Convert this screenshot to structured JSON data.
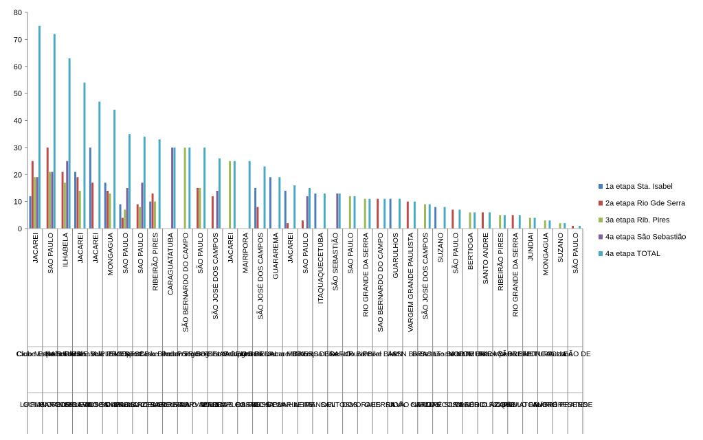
{
  "chart_data": {
    "type": "bar",
    "ylim": [
      0,
      80
    ],
    "yticks": [
      0,
      10,
      20,
      30,
      40,
      50,
      60,
      70,
      80
    ],
    "grid": false,
    "legend_position": "right",
    "categories": [
      {
        "city": "JACAREI",
        "team": "Ciclo Mania",
        "name": "GIRLEI"
      },
      {
        "city": "SAO PAULO",
        "team": "Clube Esporte Clube",
        "name": "LUCIANO ANGELI"
      },
      {
        "city": "ILHABELA",
        "team": "Ilhabela Bike",
        "name": "MARCOS SILVA"
      },
      {
        "city": "JACAREI",
        "team": "Sul de Ilhabela",
        "name": "PEDRO SANTOS"
      },
      {
        "city": "JACAREI",
        "team": "NATURAIS E SUPLEMENTOS",
        "name": "RICARDO SOUZA"
      },
      {
        "city": "MONGAGUA",
        "team": "Vale PROD.",
        "name": "JOSE CARLOS"
      },
      {
        "city": "SAO PAULO",
        "team": "Bike Sport",
        "name": "ANDRE LUIZ"
      },
      {
        "city": "SAO PAULO",
        "team": "Speed Bike",
        "name": "PAULO CESAR"
      },
      {
        "city": "RIBEIRÃO PIRES",
        "team": "Casa Bike",
        "name": "MARCELO SILVA"
      },
      {
        "city": "CARAGUATATUBA",
        "team": "Berdam",
        "name": "FABIO LIMA"
      },
      {
        "city": "SÃO BERNARDO DO CAMPO",
        "team": "Pedal Seguros",
        "name": "ANDRE CARVALHO"
      },
      {
        "city": "SÃO PAULO",
        "team": "Porto Seguros",
        "name": "FABIO SOUSA"
      },
      {
        "city": "SÃO JOSÉ DOS CAMPOS",
        "team": "TRIBO SELVAGEM",
        "name": "PEDRA"
      },
      {
        "city": "JACAREI",
        "team": "Tribo Selvagem",
        "name": "MARCOS COSTA"
      },
      {
        "city": "MAIRIPORA",
        "team": "Mairipora Bike",
        "name": "CARLOS ROCHA"
      },
      {
        "city": "SÃO JOSÉ DOS CAMPOS",
        "team": "DO PEDAL",
        "name": "RAFAEL SILVA"
      },
      {
        "city": "GUARAREMA",
        "team": "Guararema MTB",
        "name": "JOSÉ CUNHA"
      },
      {
        "city": "JACAREI",
        "team": "Jacarei Bikers",
        "name": "CESAR LEITE"
      },
      {
        "city": "SAO PAULO",
        "team": "BIKERS",
        "name": "LEITE"
      },
      {
        "city": "ITAQUAQUECETUBA",
        "team": "Itaqua Bike",
        "name": "MANOEL"
      },
      {
        "city": "SÃO SEBASTIÃO",
        "team": "DESAFIO",
        "name": "SANTOS"
      },
      {
        "city": "SAO PAULO",
        "team": "Desafio Bike",
        "name": "DOS"
      },
      {
        "city": "RIO GRANDE DA SERRA",
        "team": "Rural Bike",
        "name": "MORAES"
      },
      {
        "city": "SAO BERNARDO DO CAMPO",
        "team": "Pedal Bike",
        "name": "GUERRA"
      },
      {
        "city": "GUARULHOS",
        "team": "ASN",
        "name": "SILVA"
      },
      {
        "city": "VARGEM GRANDE PAULISTA",
        "team": "ASN Bikers",
        "name": "JOÃO NETO"
      },
      {
        "city": "SÃO JOSÉ DOS CAMPOS",
        "team": "BRASIL",
        "name": "CARLOS"
      },
      {
        "city": "SUZANO",
        "team": "Suzano Bike",
        "name": "ANDRÉ SILVA"
      },
      {
        "city": "SÃO PAULO",
        "team": "Team Norte",
        "name": "MARCOS PEDRO"
      },
      {
        "city": "BERTIOGA",
        "team": "NORTE BIKE",
        "name": "ROGÉRIO"
      },
      {
        "city": "SANTO ANDRE",
        "team": "COMUNICAÇÃO",
        "name": "CLAUDIO ROQUE"
      },
      {
        "city": "RIBEIRÃO PIRES",
        "team": "Ribeirão Bike",
        "name": "LÁZARO"
      },
      {
        "city": "RIO GRANDE DA SERRA",
        "team": "Serra Bike",
        "name": "JOSÉ MATOS"
      },
      {
        "city": "JUNDIAI",
        "team": "PREFEITURA",
        "name": "PAULO FAUSTO"
      },
      {
        "city": "MONGAGUA",
        "team": "MONGAGUA",
        "name": "MÁRIO"
      },
      {
        "city": "SUZANO",
        "team": "Suzano",
        "name": "ANDRÉ PRATES"
      },
      {
        "city": "SÃO PAULO",
        "team": "LEÃO DE",
        "name": "RESENDE"
      }
    ],
    "series": [
      {
        "name": "1a etapa Sta. Isabel",
        "color": "#4a7ebb",
        "values": [
          12,
          0,
          0,
          21,
          30,
          17,
          9,
          0,
          10,
          0,
          0,
          0,
          0,
          0,
          0,
          15,
          19,
          14,
          0,
          13,
          0,
          0,
          0,
          0,
          11,
          0,
          0,
          8,
          0,
          0,
          0,
          0,
          0,
          0,
          0,
          0,
          0
        ]
      },
      {
        "name": "2a etapa Rio Gde Serra",
        "color": "#be4b48",
        "values": [
          25,
          30,
          21,
          19,
          17,
          14,
          4,
          9,
          13,
          0,
          0,
          15,
          12,
          0,
          0,
          8,
          0,
          2,
          3,
          0,
          0,
          0,
          0,
          11,
          0,
          10,
          0,
          0,
          7,
          0,
          6,
          0,
          5,
          0,
          0,
          0,
          1
        ]
      },
      {
        "name": "3a etapa Rib. Pires",
        "color": "#98b954",
        "values": [
          19,
          21,
          17,
          14,
          0,
          13,
          7,
          8,
          10,
          0,
          30,
          15,
          0,
          25,
          0,
          0,
          0,
          0,
          0,
          0,
          0,
          12,
          11,
          0,
          0,
          0,
          9,
          0,
          0,
          6,
          0,
          5,
          0,
          4,
          3,
          2,
          0
        ]
      },
      {
        "name": "4a etapa São Sebastião",
        "color": "#7d60a0",
        "values": [
          19,
          21,
          25,
          0,
          0,
          0,
          15,
          17,
          0,
          30,
          0,
          0,
          14,
          0,
          0,
          0,
          0,
          0,
          12,
          0,
          13,
          0,
          0,
          0,
          0,
          0,
          0,
          0,
          0,
          0,
          0,
          0,
          0,
          0,
          0,
          0,
          0
        ]
      },
      {
        "name": "4a etapa TOTAL",
        "color": "#46aac5",
        "values": [
          75,
          72,
          63,
          54,
          47,
          44,
          35,
          34,
          33,
          30,
          30,
          30,
          26,
          25,
          25,
          23,
          19,
          16,
          15,
          13,
          13,
          12,
          11,
          11,
          11,
          10,
          9,
          8,
          7,
          6,
          6,
          5,
          5,
          4,
          3,
          2,
          1
        ]
      }
    ]
  }
}
